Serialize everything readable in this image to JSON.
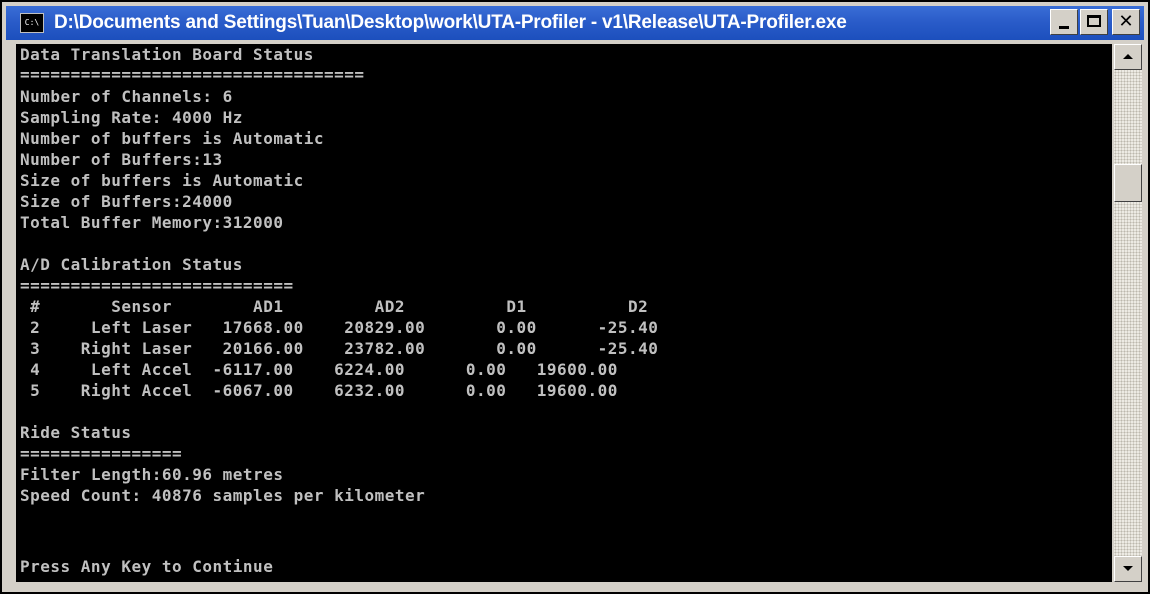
{
  "window": {
    "title": "D:\\Documents and Settings\\Tuan\\Desktop\\work\\UTA-Profiler - v1\\Release\\UTA-Profiler.exe",
    "icon_text": "C:\\",
    "icon": "console-icon"
  },
  "console": {
    "lines": [
      "Data Translation Board Status",
      "==================================",
      "Number of Channels: 6",
      "Sampling Rate: 4000 Hz",
      "Number of buffers is Automatic",
      "Number of Buffers:13",
      "Size of buffers is Automatic",
      "Size of Buffers:24000",
      "Total Buffer Memory:312000",
      "",
      "A/D Calibration Status",
      "===========================",
      " #       Sensor        AD1         AD2          D1          D2",
      " 2     Left Laser   17668.00    20829.00       0.00      -25.40",
      " 3    Right Laser   20166.00    23782.00       0.00      -25.40",
      " 4     Left Accel  -6117.00    6224.00      0.00   19600.00",
      " 5    Right Accel  -6067.00    6232.00      0.00   19600.00",
      "",
      "Ride Status",
      "================",
      "Filter Length:60.96 metres",
      "Speed Count: 40876 samples per kilometer",
      "",
      "",
      "Press Any Key to Continue"
    ]
  },
  "colors": {
    "console_bg": "#000000",
    "console_text": "#c0c0c0",
    "titlebar": "#2a5cc9"
  }
}
